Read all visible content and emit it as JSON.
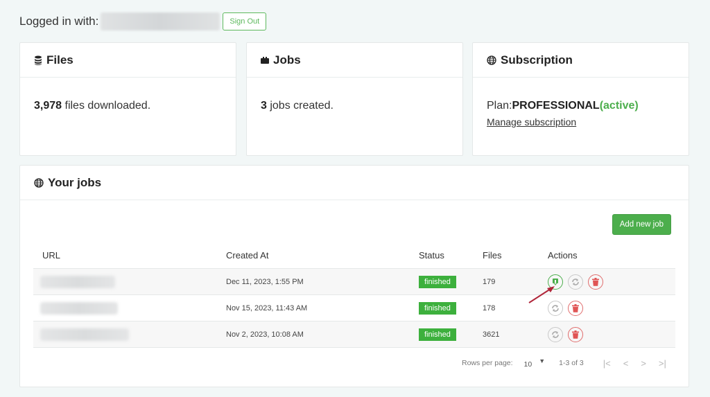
{
  "header": {
    "logged_in_label": "Logged in with:",
    "sign_out_label": "Sign Out"
  },
  "cards": {
    "files": {
      "title": "Files",
      "icon": "database-icon",
      "count": "3,978",
      "text": " files downloaded."
    },
    "jobs": {
      "title": "Jobs",
      "icon": "briefcase-icon",
      "count": "3",
      "text": " jobs created."
    },
    "subscription": {
      "title": "Subscription",
      "icon": "globe-icon",
      "plan_label": "Plan:",
      "plan_name": "PROFESSIONAL",
      "plan_status": "(active)",
      "manage_link": "Manage subscription"
    }
  },
  "jobs_panel": {
    "title": "Your jobs",
    "icon": "globe-icon",
    "add_button": "Add new job",
    "columns": [
      "URL",
      "Created At",
      "Status",
      "Files",
      "Actions"
    ],
    "rows": [
      {
        "created_at": "Dec 11, 2023, 1:55 PM",
        "status": "finished",
        "files": "179",
        "actions": [
          "download",
          "rerun",
          "delete"
        ]
      },
      {
        "created_at": "Nov 15, 2023, 11:43 AM",
        "status": "finished",
        "files": "178",
        "actions": [
          "rerun",
          "delete"
        ]
      },
      {
        "created_at": "Nov 2, 2023, 10:08 AM",
        "status": "finished",
        "files": "3621",
        "actions": [
          "rerun",
          "delete"
        ]
      }
    ],
    "pagination": {
      "rows_per_page_label": "Rows per page:",
      "rows_per_page_value": "10",
      "range": "1-3 of 3"
    }
  },
  "colors": {
    "accent": "#4cae4c",
    "danger": "#e06c6c",
    "status_finished": "#3db03d",
    "annotation_arrow": "#b0263a"
  }
}
